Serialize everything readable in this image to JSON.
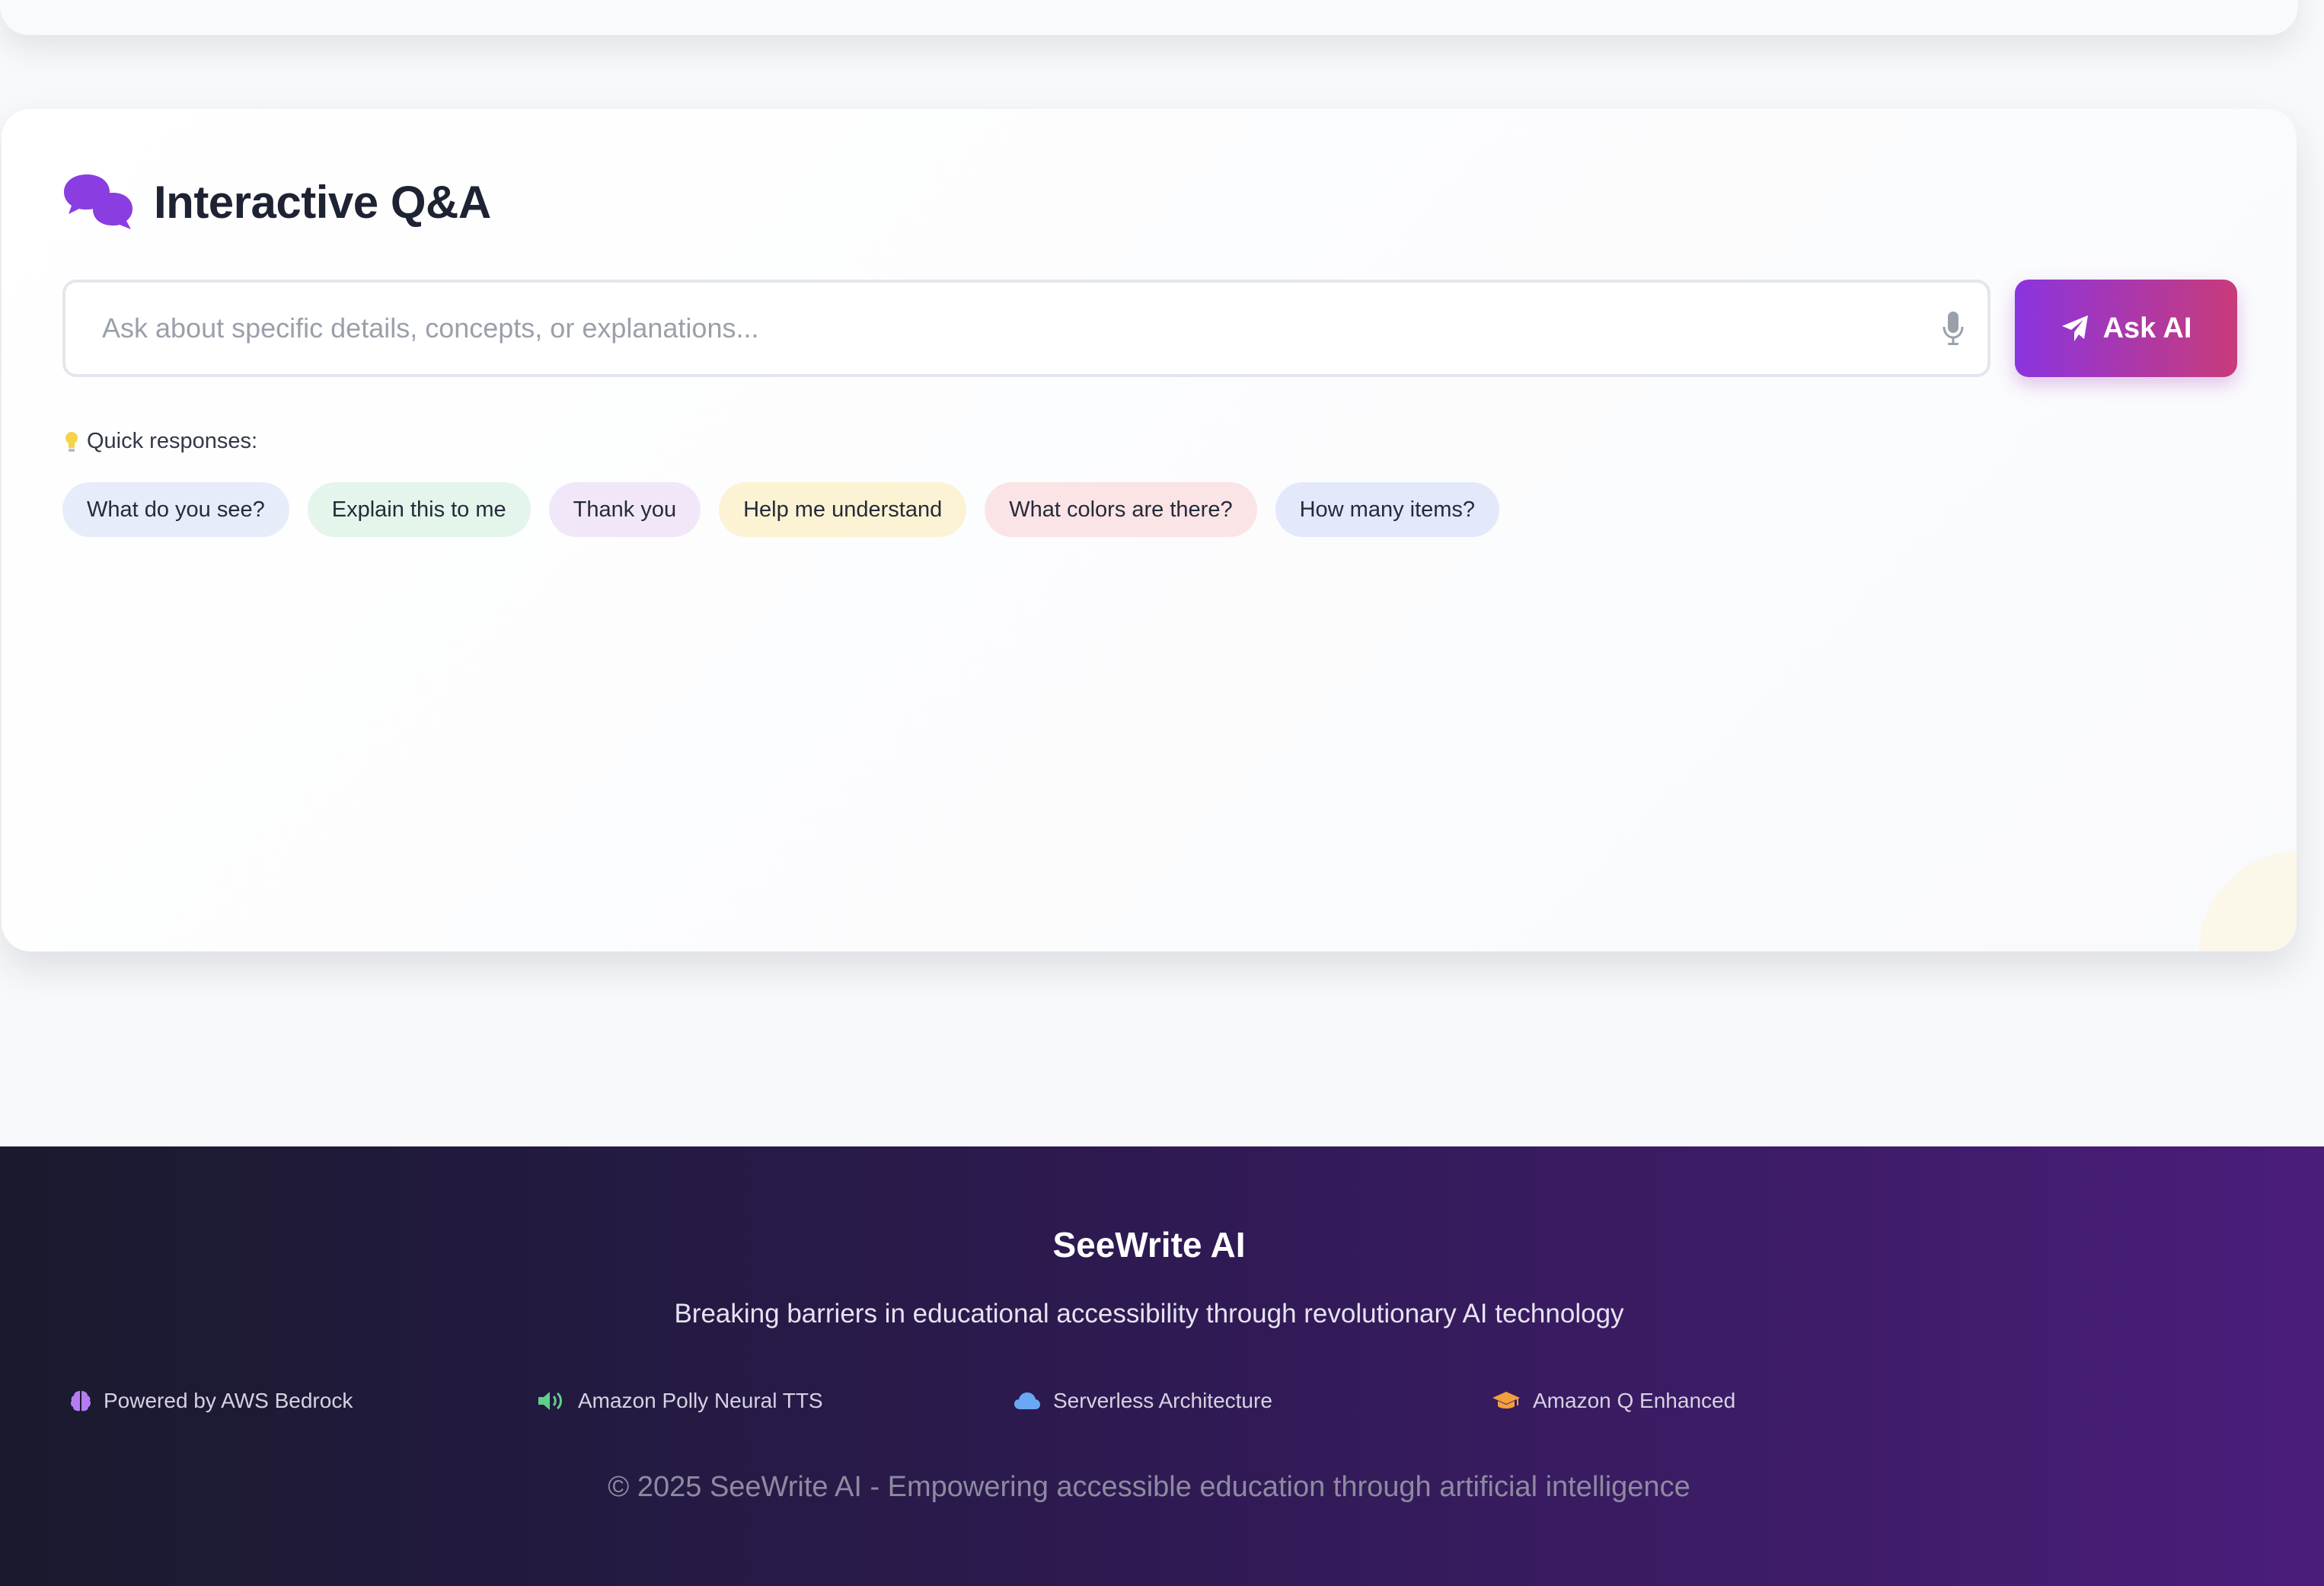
{
  "qa": {
    "title": "Interactive Q&A",
    "input_placeholder": "Ask about specific details, concepts, or explanations...",
    "input_value": "",
    "ask_button": "Ask AI",
    "quick_label": "Quick responses:",
    "quick_responses": [
      {
        "label": "What do you see?",
        "bg": "#e7ecfb"
      },
      {
        "label": "Explain this to me",
        "bg": "#e4f5ec"
      },
      {
        "label": "Thank you",
        "bg": "#f2e7f8"
      },
      {
        "label": "Help me understand",
        "bg": "#fbf3d3"
      },
      {
        "label": "What colors are there?",
        "bg": "#fbe4e6"
      },
      {
        "label": "How many items?",
        "bg": "#e3e9fb"
      }
    ]
  },
  "footer": {
    "brand": "SeeWrite AI",
    "tagline": "Breaking barriers in educational accessibility through revolutionary AI technology",
    "features": [
      {
        "label": "Powered by AWS Bedrock",
        "icon": "brain-icon",
        "color": "#b47cf0"
      },
      {
        "label": "Amazon Polly Neural TTS",
        "icon": "speaker-icon",
        "color": "#5fd08a"
      },
      {
        "label": "Serverless Architecture",
        "icon": "cloud-icon",
        "color": "#6aa8f5"
      },
      {
        "label": "Amazon Q Enhanced",
        "icon": "graduation-cap-icon",
        "color": "#f2a03d"
      }
    ],
    "copyright": "© 2025 SeeWrite AI - Empowering accessible education through artificial intelligence"
  },
  "colors": {
    "accent_start": "#8a34e0",
    "accent_end": "#c93b7a",
    "qa_icon": "#8a3de0"
  }
}
